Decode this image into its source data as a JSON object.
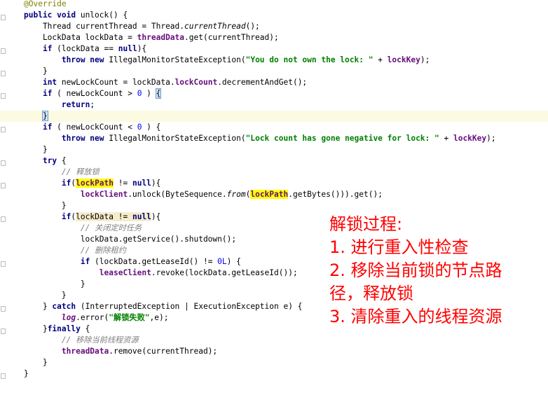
{
  "code": {
    "lines": [
      "@Override",
      "public void unlock() {",
      "    Thread currentThread = Thread.currentThread();",
      "    LockData lockData = threadData.get(currentThread);",
      "    if (lockData == null){",
      "        throw new IllegalMonitorStateException(\"You do not own the lock: \" + lockKey);",
      "    }",
      "    int newLockCount = lockData.lockCount.decrementAndGet();",
      "    if ( newLockCount > 0 ) {",
      "        return;",
      "    }",
      "    if ( newLockCount < 0 ) {",
      "        throw new IllegalMonitorStateException(\"Lock count has gone negative for lock: \" + lockKey);",
      "    }",
      "    try {",
      "        // 释放锁",
      "        if(lockPath != null){",
      "            lockClient.unlock(ByteSequence.from(lockPath.getBytes())).get();",
      "        }",
      "        if(lockData != null){",
      "            // 关闭定时任务",
      "            lockData.getService().shutdown();",
      "            // 删除租约",
      "            if (lockData.getLeaseId() != 0L) {",
      "                leaseClient.revoke(lockData.getLeaseId());",
      "            }",
      "        }",
      "    } catch (InterruptedException | ExecutionException e) {",
      "        log.error(\"解锁失败\",e);",
      "    }finally {",
      "        // 移除当前线程资源",
      "        threadData.remove(currentThread);",
      "    }",
      "}"
    ]
  },
  "annotation": {
    "title": "解锁过程:",
    "step1": "1. 进行重入性检查",
    "step2a": "2. 移除当前锁的节点路",
    "step2b": "径，释放锁",
    "step3": "3. 清除重入的线程资源"
  },
  "colors": {
    "keyword": "#000080",
    "string": "#008000",
    "field": "#660e7a",
    "comment": "#808080",
    "annotation_text": "#ff0000",
    "current_line": "#fcfae1",
    "search_highlight": "#ffff00"
  }
}
